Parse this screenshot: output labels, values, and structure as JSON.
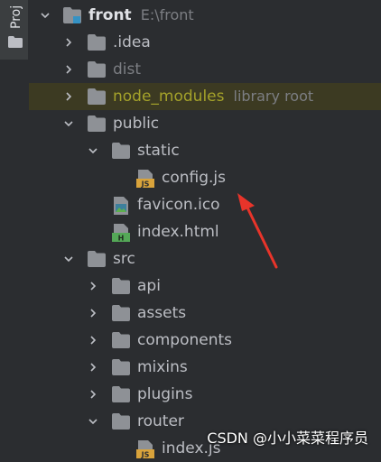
{
  "side": {
    "tab_label": "Proj"
  },
  "tree": {
    "root": {
      "name": "front",
      "path": "E:\\front"
    },
    "idea": ".idea",
    "dist": "dist",
    "node_modules": {
      "name": "node_modules",
      "hint": "library root"
    },
    "public": "public",
    "static": "static",
    "config_js": "config.js",
    "favicon": "favicon.ico",
    "index_html": "index.html",
    "src": "src",
    "api": "api",
    "assets": "assets",
    "components": "components",
    "mixins": "mixins",
    "plugins": "plugins",
    "router": "router",
    "index_js": "index.js"
  },
  "watermark": "CSDN @小小菜菜程序员",
  "colors": {
    "background": "#2b2d30",
    "folder": "#8e9196",
    "library_root_row": "#3c3a22",
    "library_text": "#a4a22a",
    "annotation_arrow": "#e8342a"
  }
}
